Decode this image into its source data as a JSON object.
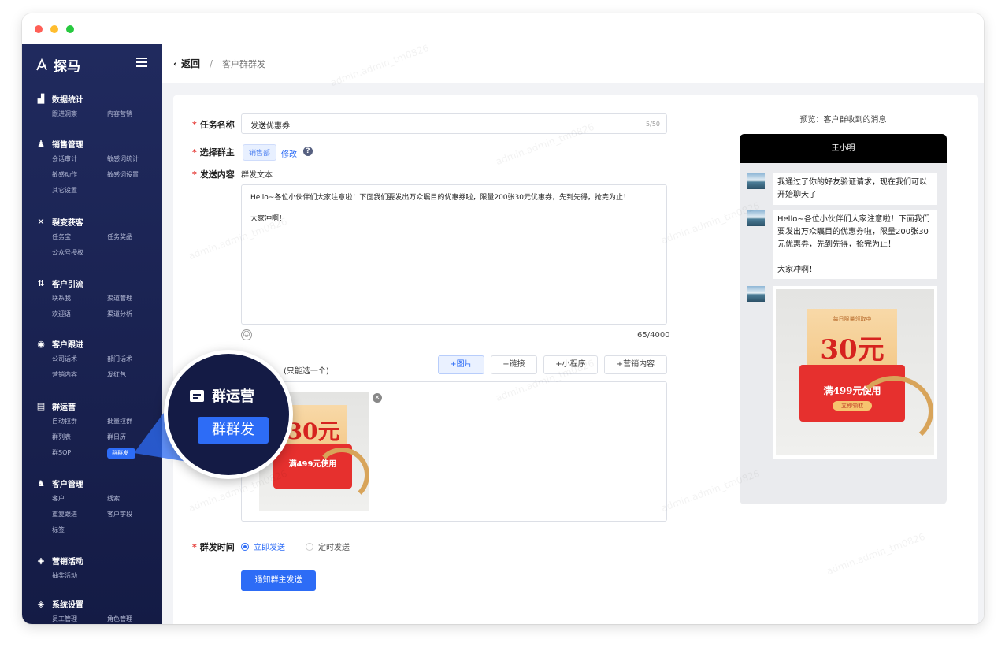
{
  "app": {
    "name": "探马"
  },
  "window_dots": [
    "#ff5f56",
    "#ffbd2e",
    "#27c93f"
  ],
  "sidebar": {
    "groups": [
      {
        "title": "数据统计",
        "icon": "chart-icon",
        "items": [
          "跟进洞察",
          "内容营销"
        ]
      },
      {
        "title": "销售管理",
        "icon": "user-icon",
        "items": [
          "会话审计",
          "敏感词统计",
          "敏感动作",
          "敏感词设置",
          "其它设置"
        ]
      },
      {
        "title": "裂变获客",
        "icon": "fission-icon",
        "items": [
          "任务宝",
          "任务奖品",
          "公众号授权"
        ]
      },
      {
        "title": "客户引流",
        "icon": "traffic-icon",
        "items": [
          "联系我",
          "渠道管理",
          "欢迎语",
          "渠道分析"
        ]
      },
      {
        "title": "客户跟进",
        "icon": "target-icon",
        "items": [
          "公司话术",
          "部门话术",
          "营销内容",
          "发红包"
        ]
      },
      {
        "title": "群运营",
        "icon": "group-chat-icon",
        "items": [
          "自动拉群",
          "批量拉群",
          "群列表",
          "群日历",
          "群SOP",
          "群群发"
        ]
      },
      {
        "title": "客户管理",
        "icon": "customer-icon",
        "items": [
          "客户",
          "线索",
          "重复跟进",
          "客户字段",
          "标签"
        ]
      },
      {
        "title": "营销活动",
        "icon": "campaign-icon",
        "items": [
          "抽奖活动"
        ]
      },
      {
        "title": "系统设置",
        "icon": "settings-icon",
        "items": [
          "员工管理",
          "角色管理"
        ]
      }
    ],
    "active_item": "群群发"
  },
  "topbar": {
    "back_label": "返回",
    "separator": "/",
    "crumb": "客户群群发"
  },
  "form": {
    "task_name": {
      "label": "任务名称",
      "value": "发送优惠券",
      "counter": "5/50"
    },
    "owner": {
      "label": "选择群主",
      "tag": "销售部",
      "edit_label": "修改"
    },
    "content": {
      "label": "发送内容",
      "type_label": "群发文本",
      "text_line1": "Hello~各位小伙伴们大家注意啦！下面我们要发出万众瞩目的优惠券啦，限量200张30元优惠券，先到先得，抢完为止！",
      "text_line2": "大家冲啊！",
      "counter": "65/4000"
    },
    "attachment": {
      "hint": "(只能选一个)",
      "buttons": [
        "+图片",
        "+链接",
        "+小程序",
        "+营销内容"
      ]
    },
    "send_time": {
      "label": "群发时间",
      "options": [
        "立即发送",
        "定时发送"
      ],
      "selected": "立即发送"
    },
    "submit_label": "通知群主发送"
  },
  "coupon": {
    "top": "每日限量领取中",
    "amount": "30元",
    "condition": "满499元使用",
    "action": "立即领取"
  },
  "preview": {
    "title": "预览：客户群收到的消息",
    "contact": "王小明",
    "messages": [
      "我通过了你的好友验证请求，现在我们可以开始聊天了",
      "Hello~各位小伙伴们大家注意啦！下面我们要发出万众瞩目的优惠券啦，限量200张30元优惠券，先到先得，抢完为止！",
      "大家冲啊！"
    ]
  },
  "callout": {
    "title": "群运营",
    "active": "群群发"
  },
  "watermark": "admin.admin_tm0826"
}
